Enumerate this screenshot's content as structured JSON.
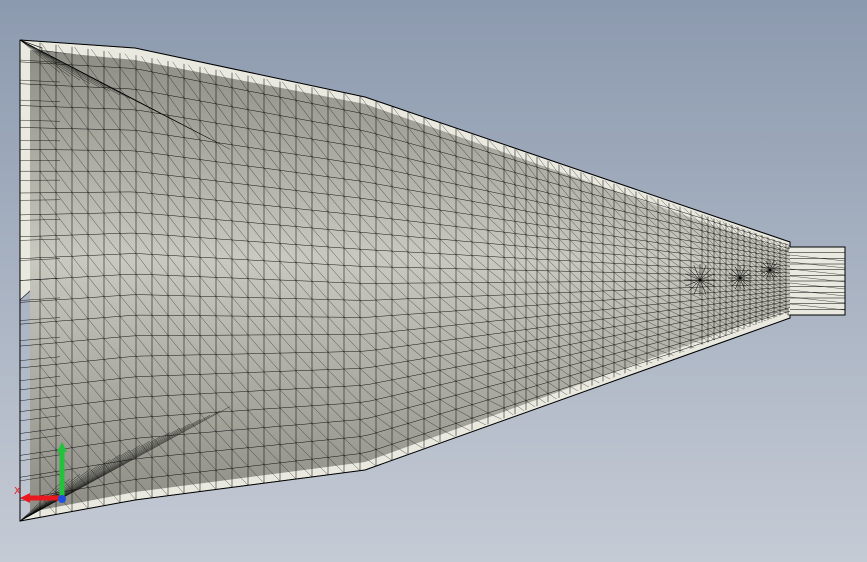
{
  "viewport": {
    "background_top": "#8c9aaf",
    "background_bottom": "#c5cbd5"
  },
  "mesh": {
    "edge_color": "#000000",
    "face_light": "#e9e9df",
    "face_mid": "#c9c9bf",
    "face_dark": "#8d8d85"
  },
  "triad": {
    "x_label": "X",
    "x_color": "#e8191f",
    "y_color": "#22c23a",
    "z_color": "#1f4fe0"
  }
}
